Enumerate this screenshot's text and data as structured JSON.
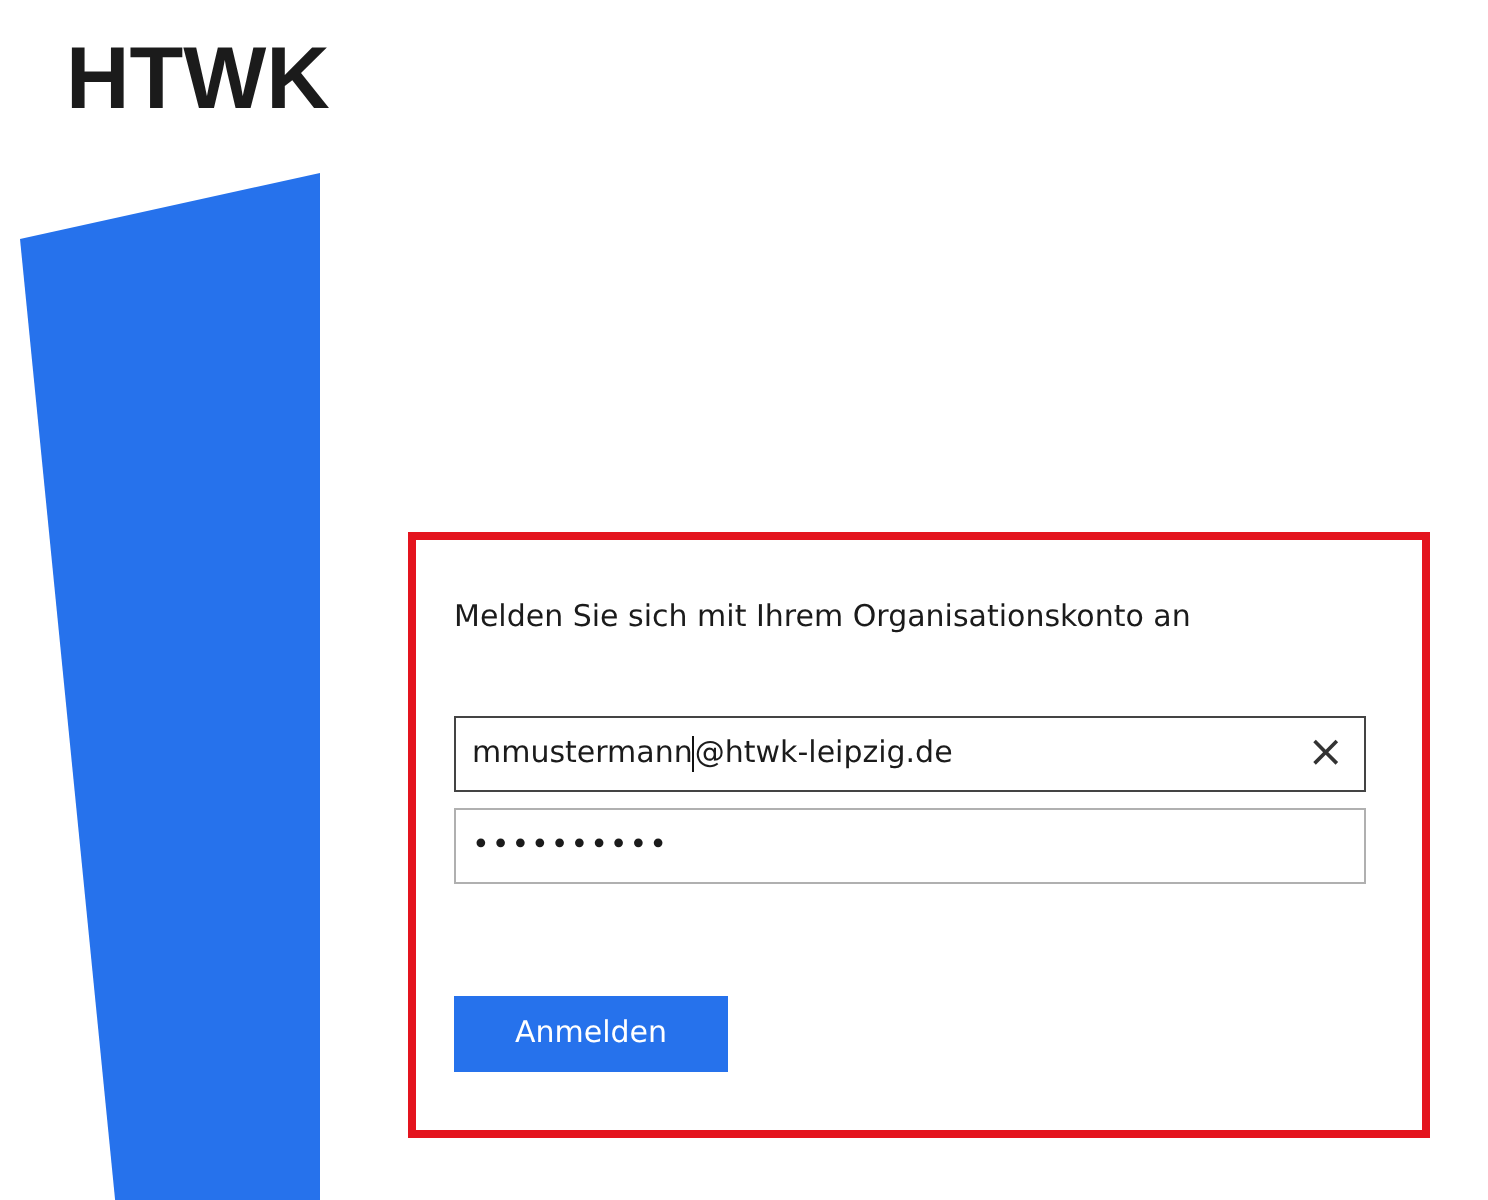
{
  "logo": {
    "text": "HTWK"
  },
  "login": {
    "heading": "Melden Sie sich mit Ihrem Organisationskonto an",
    "email": {
      "value_before_caret": "mmustermann",
      "value_after_caret": "@htwk-leipzig.de",
      "focused": true,
      "clear": "×"
    },
    "password": {
      "masked": "••••••••••",
      "focused": false
    },
    "submit": "Anmelden"
  }
}
